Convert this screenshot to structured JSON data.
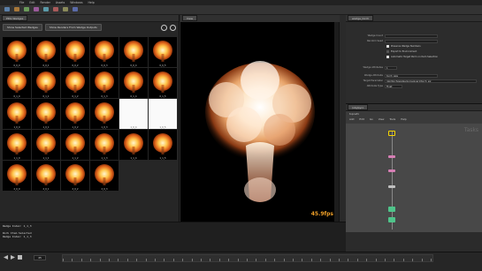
{
  "menubar": {
    "items": [
      "File",
      "Edit",
      "Render",
      "Assets",
      "Windows",
      "Help"
    ]
  },
  "left_panel": {
    "tab_label": "PDG Wedges",
    "toolbar": {
      "button1": "Show Selected Wedges",
      "button2": "Show Renders From Wedge Outputs"
    },
    "thumbnails": [
      {
        "label": "0_0_0",
        "style": "blast"
      },
      {
        "label": "0_0_1",
        "style": "blast"
      },
      {
        "label": "0_0_2",
        "style": "blast"
      },
      {
        "label": "0_0_3",
        "style": "blast"
      },
      {
        "label": "0_0_4",
        "style": "blast"
      },
      {
        "label": "0_0_5",
        "style": "blast"
      },
      {
        "label": "0_1_0",
        "style": "blast"
      },
      {
        "label": "0_1_1",
        "style": "blast"
      },
      {
        "label": "0_1_2",
        "style": "blast"
      },
      {
        "label": "0_1_3",
        "style": "blast"
      },
      {
        "label": "0_1_4",
        "style": "blast"
      },
      {
        "label": "0_1_5",
        "style": "blast"
      },
      {
        "label": "1_0_0",
        "style": "blast"
      },
      {
        "label": "1_0_1",
        "style": "blast"
      },
      {
        "label": "1_0_2",
        "style": "blast"
      },
      {
        "label": "1_0_3",
        "style": "blast"
      },
      {
        "label": "1_0_4",
        "style": "white"
      },
      {
        "label": "1_0_5",
        "style": "white"
      },
      {
        "label": "1_1_0",
        "style": "blast"
      },
      {
        "label": "1_1_1",
        "style": "blast"
      },
      {
        "label": "1_1_2",
        "style": "blast"
      },
      {
        "label": "1_1_3",
        "style": "blast"
      },
      {
        "label": "1_1_4",
        "style": "blast"
      },
      {
        "label": "1_1_5",
        "style": "blast"
      },
      {
        "label": "2_0_0",
        "style": "blast"
      },
      {
        "label": "2_0_1",
        "style": "blast"
      },
      {
        "label": "2_0_2",
        "style": "blast"
      },
      {
        "label": "2_0_3",
        "style": "blast"
      }
    ]
  },
  "viewport": {
    "tab_label": "View",
    "fps": "45.9fps",
    "camera": "Simulation Editor"
  },
  "parm_panel": {
    "title": "wedge_torch",
    "rows": [
      {
        "label": "Wedge Count",
        "value": ""
      },
      {
        "label": "Random Seed",
        "value": ""
      },
      {
        "label": "Wedge Attributes",
        "value": "1"
      },
      {
        "label": "Wedge Attribute",
        "value": "torch_size"
      },
      {
        "label": "Target Parameter",
        "value": "/obj/torch/wedge/pyrosolver1/torch_siz"
      },
      {
        "label": "Attribute Type",
        "value": "Float"
      }
    ],
    "checks": [
      "Preserve Wedge Numbers",
      "Export to Environment",
      "Automatic Target Parm on Item Selection"
    ]
  },
  "network": {
    "tab_label": "/obj/pyro",
    "path": "topnet1",
    "menu": [
      "Add",
      "Edit",
      "Go",
      "View",
      "Tools",
      "Help"
    ],
    "watermark": "Tasks"
  },
  "console": {
    "lines": [
      "Wedge Index: 1_1_3",
      "",
      "Work Item Selected",
      "Wedge Index: 1_1_3"
    ]
  },
  "timeline": {
    "frame": "45"
  }
}
